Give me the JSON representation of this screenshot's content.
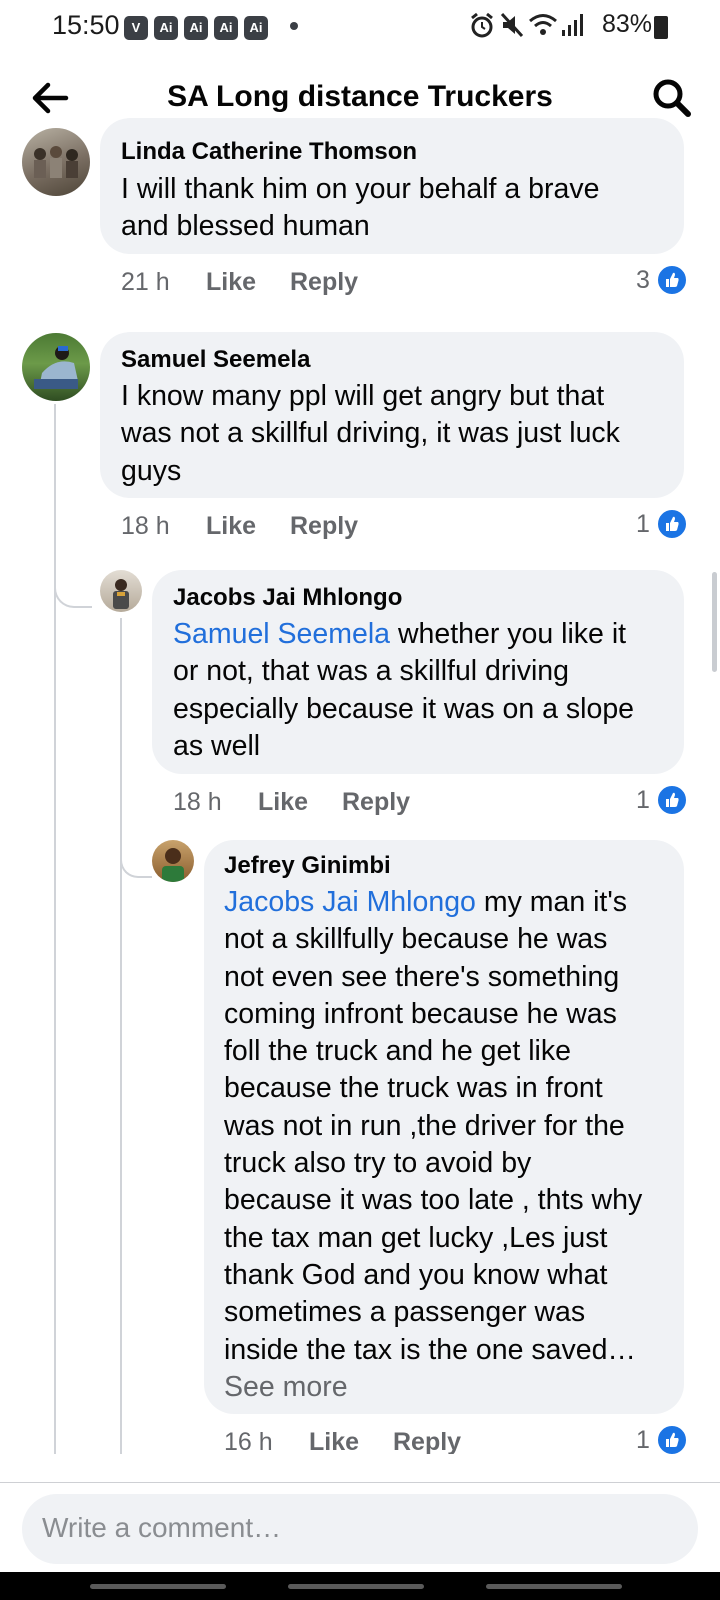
{
  "status_bar": {
    "time": "15:50",
    "badges": [
      "V",
      "Ai",
      "Ai",
      "Ai",
      "Ai"
    ],
    "battery": "83%",
    "icons": [
      "alarm-icon",
      "mute-icon",
      "wifi-icon",
      "signal-icon",
      "battery-icon"
    ]
  },
  "header": {
    "title": "SA Long distance Truckers",
    "back_icon": "arrow-left-icon",
    "search_icon": "search-icon"
  },
  "comments": [
    {
      "author": "Linda Catherine Thomson",
      "lines": [
        "I will thank him on your behalf a brave",
        "and blessed human"
      ],
      "time": "21 h",
      "like": "Like",
      "reply": "Reply",
      "reactions": "3"
    },
    {
      "author": "Samuel Seemela",
      "lines": [
        "I know many ppl will get angry but that",
        "was not a skillful driving, it was just luck",
        "guys"
      ],
      "time": "18 h",
      "like": "Like",
      "reply": "Reply",
      "reactions": "1"
    },
    {
      "author": "Jacobs Jai Mhlongo",
      "mention": "Samuel Seemela",
      "lines": [
        " whether you like it",
        "or not, that was a skillful driving",
        "especially because it was on a slope",
        "as well"
      ],
      "time": "18 h",
      "like": "Like",
      "reply": "Reply",
      "reactions": "1"
    },
    {
      "author": "Jefrey Ginimbi",
      "mention": "Jacobs Jai Mhlongo",
      "lines": [
        " my man it's",
        "not a skillfully because he was",
        "not even see there's something",
        "coming infront because he was",
        "foll the truck and he get like",
        "because the truck was in front",
        "was not in run ,the driver for the",
        "truck also try to avoid by",
        "because it was too late , thts why",
        "the tax man get lucky ,Les just",
        "thank God and you know what",
        "sometimes a passenger was",
        "inside the tax is the one saved…"
      ],
      "see_more": "See more",
      "time": "16 h",
      "like": "Like",
      "reply": "Reply",
      "reactions": "1"
    }
  ],
  "composer": {
    "placeholder": "Write a comment…"
  },
  "colors": {
    "bubble": "#f0f2f5",
    "mention": "#216fdb",
    "meta": "#65676b",
    "like_badge": "#1b74e4"
  }
}
